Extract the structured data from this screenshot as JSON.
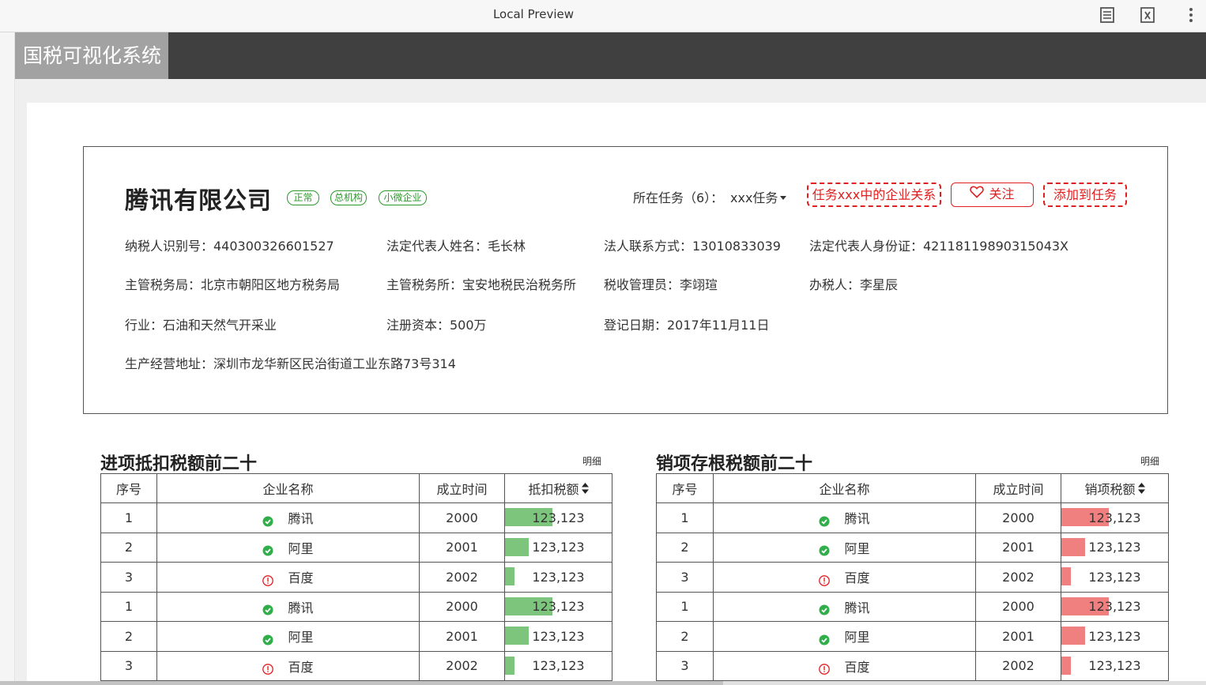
{
  "preview": {
    "title": "Local Preview"
  },
  "app": {
    "title": "国税可视化系统"
  },
  "company": {
    "name": "腾讯有限公司",
    "tags": [
      "正常",
      "总机构",
      "小微企业"
    ],
    "task_label": "所在任务（6）：",
    "task_value": "xxx任务",
    "buttons": {
      "relation": "任务xxx中的企业关系",
      "follow": "关注",
      "add": "添加到任务"
    },
    "info": {
      "taxpayer_id": "纳税人识别号：440300326601527",
      "legal_rep": "法定代表人姓名：毛长林",
      "legal_contact": "法人联系方式：13010833039",
      "legal_id": "法定代表人身份证：42118119890315043X",
      "tax_bureau": "主管税务局：北京市朝阳区地方税务局",
      "tax_office": "主管税务所：宝安地税民治税务所",
      "tax_admin": "税收管理员：李翊瑄",
      "tax_agent": "办税人：李星辰",
      "industry": "行业：石油和天然气开采业",
      "capital": "注册资本：500万",
      "reg_date": "登记日期：2017年11月11日",
      "address": "生产经营地址：深圳市龙华新区民治街道工业东路73号314"
    }
  },
  "input_table": {
    "title": "进项抵扣税额前二十",
    "detail": "明细",
    "headers": [
      "序号",
      "企业名称",
      "成立时间",
      "抵扣税额"
    ],
    "bar_color": "#7dc47d",
    "rows": [
      {
        "no": "1",
        "name": "腾讯",
        "status": "ok",
        "year": "2000",
        "amount": "123,123",
        "bar": 0.44
      },
      {
        "no": "2",
        "name": "阿里",
        "status": "ok",
        "year": "2001",
        "amount": "123,123",
        "bar": 0.22
      },
      {
        "no": "3",
        "name": "百度",
        "status": "warn",
        "year": "2002",
        "amount": "123,123",
        "bar": 0.09
      },
      {
        "no": "1",
        "name": "腾讯",
        "status": "ok",
        "year": "2000",
        "amount": "123,123",
        "bar": 0.44
      },
      {
        "no": "2",
        "name": "阿里",
        "status": "ok",
        "year": "2001",
        "amount": "123,123",
        "bar": 0.22
      },
      {
        "no": "3",
        "name": "百度",
        "status": "warn",
        "year": "2002",
        "amount": "123,123",
        "bar": 0.09
      }
    ]
  },
  "output_table": {
    "title": "销项存根税额前二十",
    "detail": "明细",
    "headers": [
      "序号",
      "企业名称",
      "成立时间",
      "销项税额"
    ],
    "bar_color": "#f08080",
    "rows": [
      {
        "no": "1",
        "name": "腾讯",
        "status": "ok",
        "year": "2000",
        "amount": "123,123",
        "bar": 0.44
      },
      {
        "no": "2",
        "name": "阿里",
        "status": "ok",
        "year": "2001",
        "amount": "123,123",
        "bar": 0.22
      },
      {
        "no": "3",
        "name": "百度",
        "status": "warn",
        "year": "2002",
        "amount": "123,123",
        "bar": 0.09
      },
      {
        "no": "1",
        "name": "腾讯",
        "status": "ok",
        "year": "2000",
        "amount": "123,123",
        "bar": 0.44
      },
      {
        "no": "2",
        "name": "阿里",
        "status": "ok",
        "year": "2001",
        "amount": "123,123",
        "bar": 0.22
      },
      {
        "no": "3",
        "name": "百度",
        "status": "warn",
        "year": "2002",
        "amount": "123,123",
        "bar": 0.09
      }
    ]
  },
  "colors": {
    "ok": "#2fae4a",
    "warn": "#e02020",
    "accent": "#e02020",
    "header_bg": "#404040"
  }
}
